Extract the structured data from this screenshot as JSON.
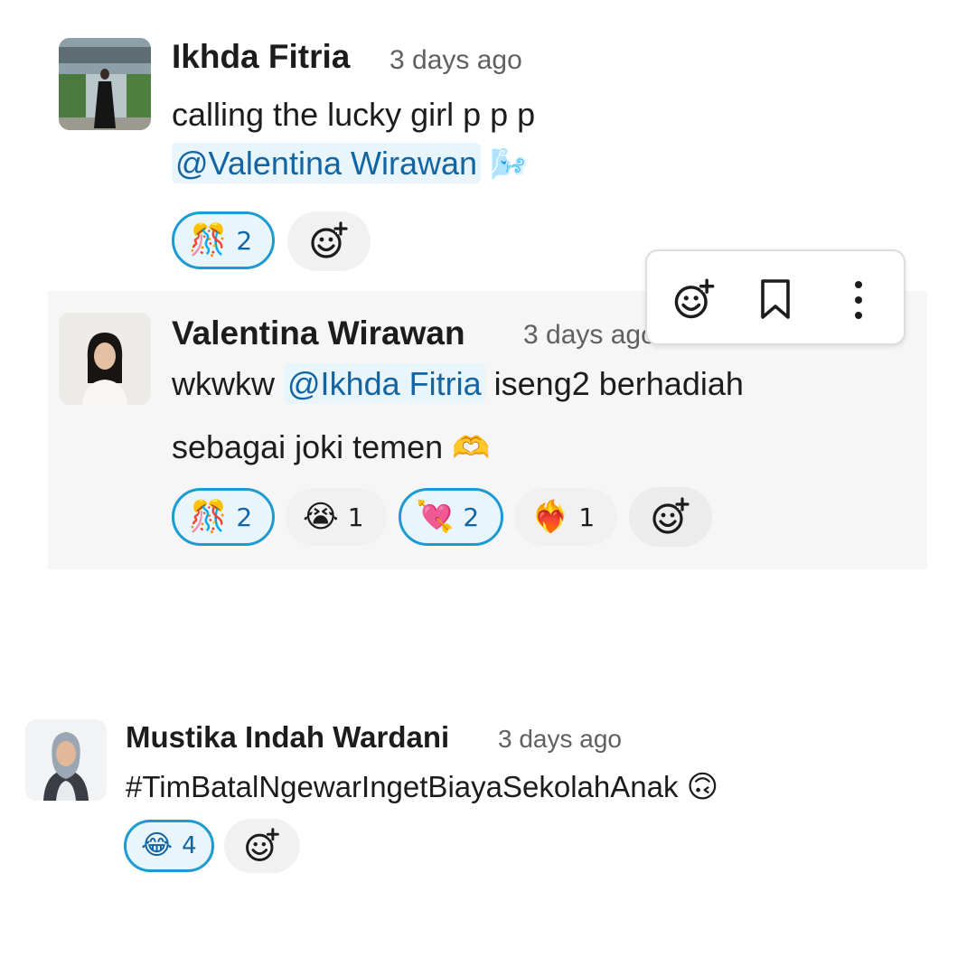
{
  "messages": [
    {
      "author": "Ikhda Fitria",
      "time": "3 days ago",
      "line1": "calling the lucky girl p p p",
      "mention": "@Valentina Wirawan",
      "mention_trailing_emoji": "🌬️",
      "reactions": [
        {
          "emoji": "🎊",
          "count": "2",
          "active": true
        }
      ]
    },
    {
      "author": "Valentina Wirawan",
      "time": "3 days ago",
      "line1_prefix": "wkwkw",
      "mention": "@Ikhda Fitria",
      "line1_suffix": "iseng2 berhadiah",
      "line2": "sebagai joki temen",
      "line2_emoji": "🫶",
      "reactions": [
        {
          "emoji": "🎊",
          "count": "2",
          "active": true
        },
        {
          "emoji": "😭",
          "count": "1",
          "active": false
        },
        {
          "emoji": "💘",
          "count": "2",
          "active": true
        },
        {
          "emoji": "❤️‍🔥",
          "count": "1",
          "active": false
        }
      ]
    },
    {
      "author": "Mustika Indah Wardani",
      "time": "3 days ago",
      "text": "#TimBatalNgewarIngetBiayaSekolahAnak",
      "text_emoji": "🙃",
      "reactions": [
        {
          "emoji": "😂",
          "count": "4",
          "active": true
        }
      ]
    }
  ],
  "toolbar": {
    "icons": [
      "add-reaction-icon",
      "bookmark-icon",
      "more-actions-icon"
    ]
  },
  "colors": {
    "mention_bg": "#e8f5fa",
    "mention_text": "#1264a3",
    "active_reaction_border": "#1d9bd1",
    "hover_bg": "#f6f6f6"
  }
}
